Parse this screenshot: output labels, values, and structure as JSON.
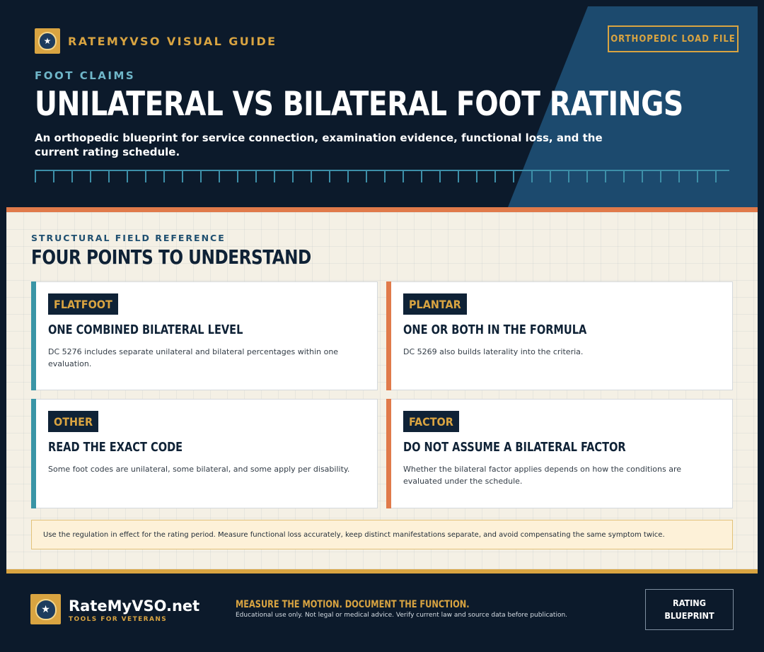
{
  "header": {
    "brand": "RATEMYVSO VISUAL GUIDE",
    "file_tag": "ORTHOPEDIC LOAD FILE",
    "eyebrow": "FOOT CLAIMS",
    "title": "UNILATERAL VS BILATERAL FOOT RATINGS",
    "subtitle": "An orthopedic blueprint for service connection, examination evidence, functional loss, and the current rating schedule."
  },
  "section": {
    "eyebrow": "STRUCTURAL FIELD REFERENCE",
    "title": "FOUR POINTS TO UNDERSTAND"
  },
  "cards": [
    {
      "tag": "FLATFOOT",
      "title": "ONE COMBINED BILATERAL LEVEL",
      "body": "DC 5276 includes separate unilateral and bilateral percentages within one evaluation."
    },
    {
      "tag": "PLANTAR",
      "title": "ONE OR BOTH IN THE FORMULA",
      "body": "DC 5269 also builds laterality into the criteria."
    },
    {
      "tag": "OTHER",
      "title": "READ THE EXACT CODE",
      "body": "Some foot codes are unilateral, some bilateral, and some apply per disability."
    },
    {
      "tag": "FACTOR",
      "title": "DO NOT ASSUME A BILATERAL FACTOR",
      "body": "Whether the bilateral factor applies depends on how the conditions are evaluated under the schedule."
    }
  ],
  "note": "Use the regulation in effect for the rating period. Measure functional loss accurately, keep distinct manifestations separate, and avoid compensating the same symptom twice.",
  "footer": {
    "brand": "RateMyVSO.net",
    "tagline": "TOOLS FOR VETERANS",
    "motto": "MEASURE THE MOTION. DOCUMENT THE FUNCTION.",
    "disclaimer": "Educational use only. Not legal or medical advice. Verify current law and source data before publication.",
    "stamp_line1": "RATING",
    "stamp_line2": "BLUEPRINT"
  },
  "colors": {
    "navy": "#0c1a2b",
    "panel_blue": "#1c4a6e",
    "gold": "#d9a441",
    "teal": "#3a95a6",
    "orange": "#e07a4a",
    "paper": "#f4f0e5"
  },
  "icons": {
    "brand_badge": "shield-star-icon"
  }
}
